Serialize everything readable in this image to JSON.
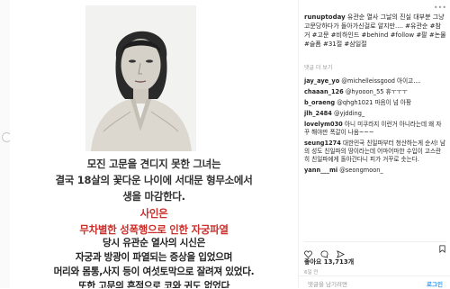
{
  "post": {
    "username": "runuptoday",
    "caption": "유관순 열사 그날의 진실 대부분 그냥 고문당하다가 돌아가신걸로 알지만.... #유관순 #참거 #고문 #비하인드 #behind #follow #팔 #논물 #슬픔 #31절 #삼일절",
    "meta": "댓글 더 보기",
    "likes": "좋아요 13,713개",
    "date": "6일 전",
    "add_comment_placeholder": "댓글을 남기려면",
    "login_label": "로그인"
  },
  "comments": [
    {
      "user": "jay_aye_yo",
      "text": "@michelleissgood 아이고...."
    },
    {
      "user": "chaaan_126",
      "text": "@hyooon_55 휴ㅜㅜㅜ"
    },
    {
      "user": "b_oraeng",
      "text": "@qhgh1021 마음이 넘 아팡"
    },
    {
      "user": "jlh_2484",
      "text": "@yjdding_"
    },
    {
      "user": "lovelym030",
      "text": "아니 미쿠라지 이런거 아니라는데 왜 자꾸 해야만 폭갈이 나옴~~~"
    },
    {
      "user": "seung1274",
      "text": "대한민국 친일파부터 청산하는게 순서! 남의 성도 친일파의 땅이라는데 어마어마한 수입이 고스란히 친일파에게 돌아간다니 피가 거꾸로 솟는다."
    },
    {
      "user": "yann___mi",
      "text": "@seongmoon_"
    }
  ],
  "image": {
    "line1": "모진 고문을 견디지 못한 그녀는",
    "line2": "결국 18살의 꽃다운 나이에 서대문 형무소에서",
    "line3": "생을 마감한다.",
    "line4": "사인은",
    "line5": "무차별한 성폭행으로 인한 자궁파열",
    "line6": "당시 유관순 열사의 시신은",
    "line7": "자궁과 방광이 파열되는 증상을 입었으며",
    "line8": "머리와 몸통,사지 등이 여섯토막으로 잘려져 있었다.",
    "line9": "또한 고문의 흔적으로 코와 귀도 없었다"
  }
}
